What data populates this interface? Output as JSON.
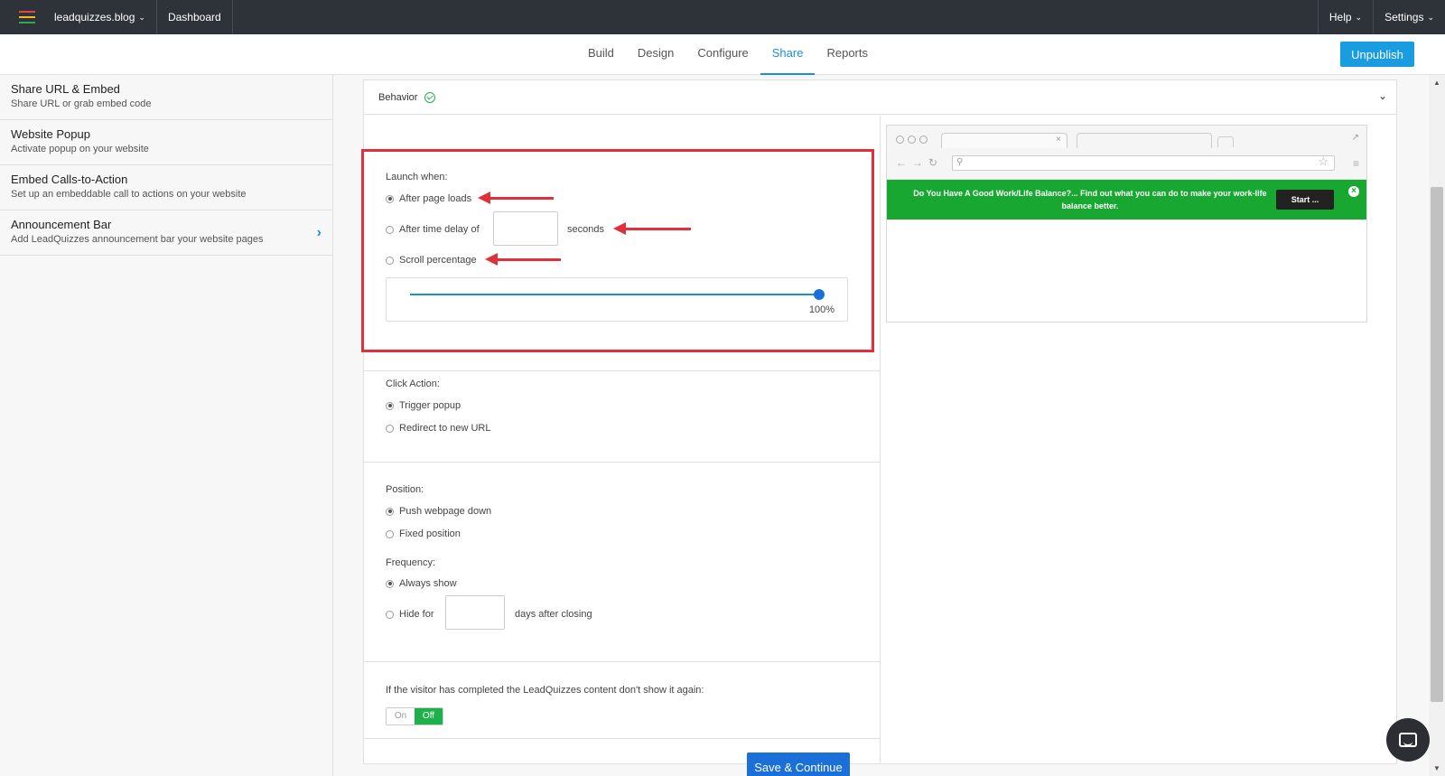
{
  "topbar": {
    "site_name": "leadquizzes.blog",
    "dashboard": "Dashboard",
    "help": "Help",
    "settings": "Settings",
    "logo_colors": [
      "#e8463a",
      "#f5b72a",
      "#2fa84f"
    ]
  },
  "tabs": [
    "Build",
    "Design",
    "Configure",
    "Share",
    "Reports"
  ],
  "active_tab": "Share",
  "unpublish_label": "Unpublish",
  "sidebar": {
    "items": [
      {
        "title": "Share URL & Embed",
        "desc": "Share URL or grab embed code"
      },
      {
        "title": "Website Popup",
        "desc": "Activate popup on your website"
      },
      {
        "title": "Embed Calls-to-Action",
        "desc": "Set up an embeddable call to actions on your website"
      },
      {
        "title": "Announcement Bar",
        "desc": "Add LeadQuizzes announcement bar your website pages"
      }
    ]
  },
  "behavior": {
    "title": "Behavior",
    "launch": {
      "label": "Launch when:",
      "opt_page_load": "After page loads",
      "opt_delay": "After time delay of",
      "delay_value": "",
      "seconds": "seconds",
      "opt_scroll": "Scroll percentage",
      "scroll_value": "100%",
      "scroll_fraction": 1.0
    },
    "click": {
      "label": "Click Action:",
      "opt_trigger": "Trigger popup",
      "opt_redirect": "Redirect to new URL"
    },
    "position": {
      "label": "Position:",
      "opt_push": "Push webpage down",
      "opt_fixed": "Fixed position"
    },
    "frequency": {
      "label": "Frequency:",
      "opt_always": "Always show",
      "opt_hide": "Hide for",
      "hide_days_value": "",
      "days_after": "days after closing"
    },
    "completed": {
      "label": "If the visitor has completed the LeadQuizzes content don't show it again:",
      "on": "On",
      "off": "Off"
    },
    "save_label": "Save & Continue"
  },
  "preview": {
    "banner_text": "Do You Have A Good Work/Life Balance?... Find out what you can do to make your work-life balance better.",
    "banner_button": "Start ...",
    "banner_color": "#18a832"
  },
  "colors": {
    "accent": "#1a8fd8",
    "highlight": "#e0303a",
    "toggle_off": "#1db04b"
  }
}
